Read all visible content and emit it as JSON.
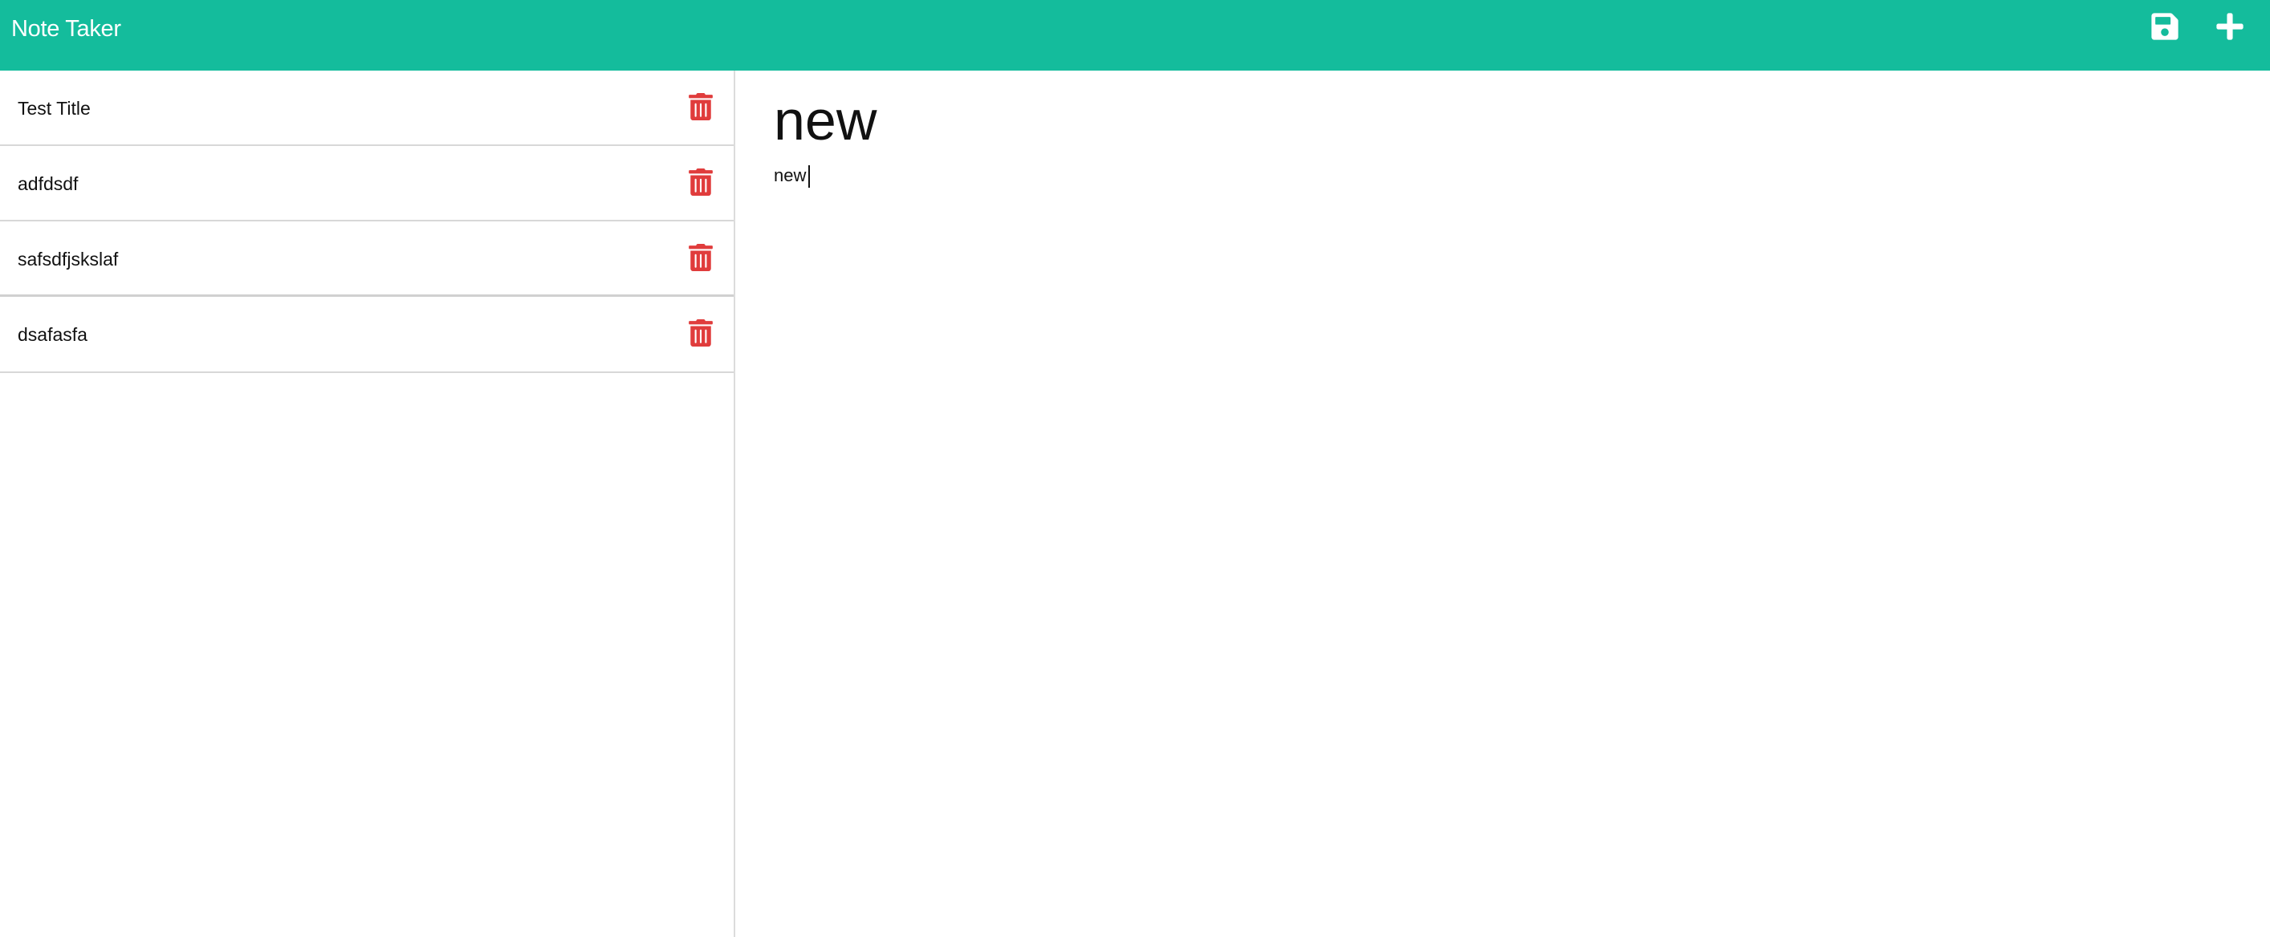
{
  "navbar": {
    "brand": "Note Taker",
    "background": "#14bc9c",
    "actions": [
      {
        "name": "save",
        "icon": "floppy-disk-icon"
      },
      {
        "name": "new-note",
        "icon": "plus-icon"
      }
    ]
  },
  "sidebar": {
    "notes": [
      {
        "title": "Test Title",
        "delete_icon": "trash-icon"
      },
      {
        "title": "adfdsdf",
        "delete_icon": "trash-icon"
      },
      {
        "title": "safsdfjskslaf",
        "delete_icon": "trash-icon"
      },
      {
        "title": "dsafasfa",
        "delete_icon": "trash-icon"
      }
    ],
    "delete_color": "#e03c3c"
  },
  "editor": {
    "title_value": "new",
    "body_value": "new"
  }
}
